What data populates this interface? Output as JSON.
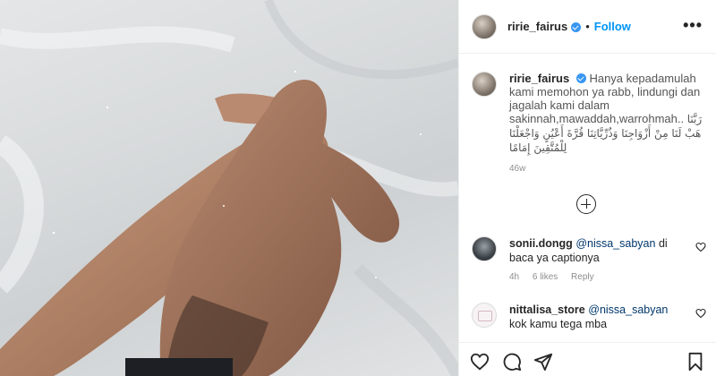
{
  "post": {
    "username": "ririe_fairus",
    "dot": "•",
    "follow_label": "Follow",
    "more_label": "•••"
  },
  "caption": {
    "username": "ririe_fairus",
    "text": "Hanya kepadamulah kami memohon ya rabb, lindungi dan jagalah kami dalam sakinnah,mawaddah,warrohmah..",
    "arabic": "رَبَّنَا هَبْ لَنَا مِنْ أَزْوَاجِنَا وَذُرِّيَّاتِنَا قُرَّةَ أَعْيُنٍ وَاجْعَلْنَا لِلْمُتَّقِينَ إِمَامًا",
    "age": "46w"
  },
  "comments": [
    {
      "username": "sonii.dongg",
      "mention": "@nissa_sabyan",
      "text": "di baca ya captionya",
      "time": "4h",
      "likes": "6 likes",
      "reply": "Reply"
    },
    {
      "username": "nittalisa_store",
      "mention": "@nissa_sabyan",
      "text": "kok kamu tega mba"
    }
  ],
  "icons": {
    "verified": "verified-badge-icon",
    "more": "more-options-icon",
    "load_more": "plus-circle-icon",
    "heart": "heart-icon",
    "comment": "comment-icon",
    "share": "share-icon",
    "save": "bookmark-icon"
  },
  "colors": {
    "accent": "#0095f6",
    "verified": "#3897f0",
    "text": "#262626",
    "muted": "#8e8e8e"
  }
}
